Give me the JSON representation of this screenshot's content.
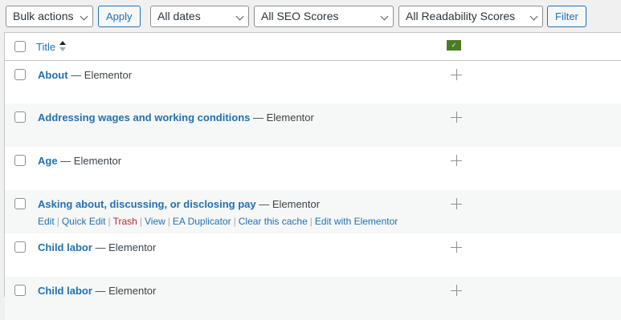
{
  "filters": {
    "bulk_actions": "Bulk actions",
    "apply": "Apply",
    "dates": "All dates",
    "seo": "All SEO Scores",
    "readability": "All Readability Scores",
    "filter": "Filter"
  },
  "table": {
    "column_title": "Title",
    "seo_column_icon": "yoast-seo-icon",
    "rows": [
      {
        "title": "About",
        "state": " — Elementor"
      },
      {
        "title": "Addressing wages and working conditions",
        "state": " — Elementor"
      },
      {
        "title": "Age",
        "state": " — Elementor"
      },
      {
        "title": "Asking about, discussing, or disclosing pay",
        "state": " — Elementor",
        "actions": [
          "Edit",
          "Quick Edit",
          "Trash",
          "View",
          "EA Duplicator",
          "Clear this cache",
          "Edit with Elementor"
        ]
      },
      {
        "title": "Child labor",
        "state": " — Elementor"
      },
      {
        "title": "Child labor",
        "state": " — Elementor"
      }
    ]
  },
  "colors": {
    "link": "#2271b1",
    "trash": "#b32d2e",
    "seo_badge": "#4a7c23"
  }
}
